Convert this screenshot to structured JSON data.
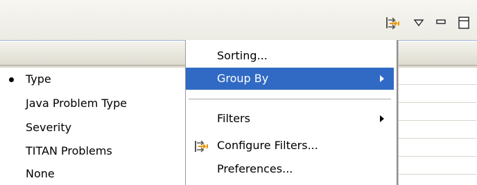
{
  "toolbar": {
    "icons": [
      "configure-filters-icon",
      "view-menu-icon",
      "minimize-icon",
      "maximize-icon"
    ]
  },
  "context_menu": {
    "items": [
      {
        "label": "Sorting...",
        "submenu": false
      },
      {
        "label": "Group By",
        "submenu": true,
        "selected": true
      },
      {
        "label": "Filters",
        "submenu": true
      },
      {
        "label": "Configure Filters...",
        "icon": "configure-filters-icon"
      },
      {
        "label": "Preferences..."
      }
    ]
  },
  "group_by_menu": {
    "items": [
      {
        "label": "Type",
        "checked": true
      },
      {
        "label": "Java Problem Type"
      },
      {
        "label": "Severity"
      },
      {
        "label": "TITAN Problems"
      },
      {
        "label": "None"
      }
    ]
  },
  "colors": {
    "selection": "#316ac5",
    "toolbar_bg": "#ecebe4",
    "icon_accent": "#f0a81e"
  }
}
